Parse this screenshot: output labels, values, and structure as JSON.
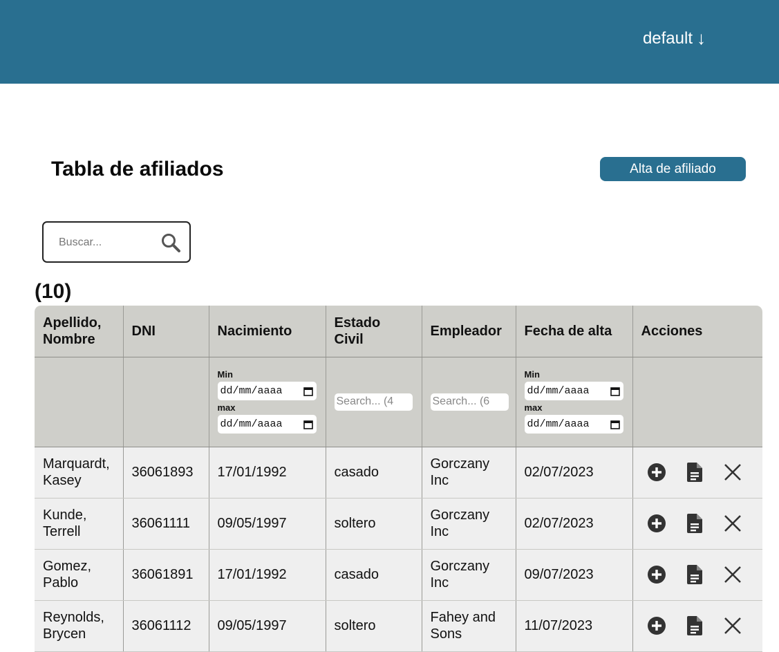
{
  "header": {
    "user_label": "default",
    "user_arrow": "↓"
  },
  "page": {
    "title": "Tabla de afiliados",
    "add_button": "Alta de afiliado",
    "search_placeholder": "Buscar...",
    "count": "(10)"
  },
  "table": {
    "headers": [
      "Apellido, Nombre",
      "DNI",
      "Nacimiento",
      "Estado Civil",
      "Empleador",
      "Fecha de alta",
      "Acciones"
    ],
    "filters": {
      "min_label": "Min",
      "max_label": "max",
      "date_placeholder": "dd/mm/aaaa",
      "estado_placeholder": "Search... (4",
      "empleador_placeholder": "Search... (6"
    },
    "rows": [
      {
        "nombre": "Marquardt, Kasey",
        "dni": "36061893",
        "nacimiento": "17/01/1992",
        "estado": "casado",
        "empleador": "Gorczany Inc",
        "alta": "02/07/2023"
      },
      {
        "nombre": "Kunde, Terrell",
        "dni": "36061111",
        "nacimiento": "09/05/1997",
        "estado": "soltero",
        "empleador": "Gorczany Inc",
        "alta": "02/07/2023"
      },
      {
        "nombre": "Gomez, Pablo",
        "dni": "36061891",
        "nacimiento": "17/01/1992",
        "estado": "casado",
        "empleador": "Gorczany Inc",
        "alta": "09/07/2023"
      },
      {
        "nombre": "Reynolds, Brycen",
        "dni": "36061112",
        "nacimiento": "09/05/1997",
        "estado": "soltero",
        "empleador": "Fahey and Sons",
        "alta": "11/07/2023"
      }
    ]
  },
  "icons": {
    "add": "plus-circle-icon",
    "doc": "document-icon",
    "delete": "close-icon"
  },
  "colors": {
    "primary": "#296f90",
    "table_header": "#cfcfca",
    "row_bg": "#efefef"
  }
}
